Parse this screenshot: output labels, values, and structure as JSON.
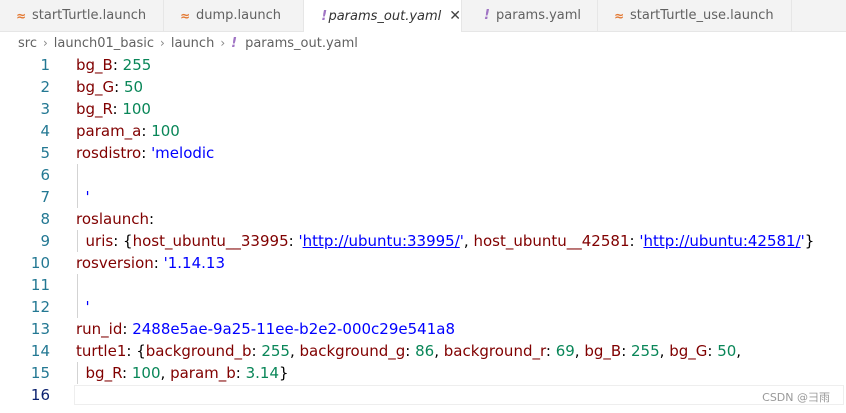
{
  "tabs": [
    {
      "label": "startTurtle.launch",
      "icon": "xml-icon",
      "italic": false,
      "active": false,
      "width": 164
    },
    {
      "label": "dump.launch",
      "icon": "xml-icon",
      "italic": false,
      "active": false,
      "width": 140
    },
    {
      "label": "params_out.yaml",
      "icon": "yaml-icon",
      "italic": true,
      "active": true,
      "width": 158
    },
    {
      "label": "params.yaml",
      "icon": "yaml-icon",
      "italic": false,
      "active": false,
      "width": 136
    },
    {
      "label": "startTurtle_use.launch",
      "icon": "xml-icon",
      "italic": false,
      "active": false,
      "width": 194
    }
  ],
  "breadcrumb": [
    "src",
    "launch01_basic",
    "launch",
    "params_out.yaml"
  ],
  "lines": [
    [
      {
        "t": "bg_B",
        "c": "key"
      },
      {
        "t": ": ",
        "c": "plain"
      },
      {
        "t": "255",
        "c": "num"
      }
    ],
    [
      {
        "t": "bg_G",
        "c": "key"
      },
      {
        "t": ": ",
        "c": "plain"
      },
      {
        "t": "50",
        "c": "num"
      }
    ],
    [
      {
        "t": "bg_R",
        "c": "key"
      },
      {
        "t": ": ",
        "c": "plain"
      },
      {
        "t": "100",
        "c": "num"
      }
    ],
    [
      {
        "t": "param_a",
        "c": "key"
      },
      {
        "t": ": ",
        "c": "plain"
      },
      {
        "t": "100",
        "c": "num"
      }
    ],
    [
      {
        "t": "rosdistro",
        "c": "key"
      },
      {
        "t": ": ",
        "c": "plain"
      },
      {
        "t": "'melodic",
        "c": "str"
      }
    ],
    [],
    [
      {
        "t": "  '",
        "c": "str"
      }
    ],
    [
      {
        "t": "roslaunch",
        "c": "key"
      },
      {
        "t": ":",
        "c": "plain"
      }
    ],
    [
      {
        "t": "  uris",
        "c": "key"
      },
      {
        "t": ": {",
        "c": "plain"
      },
      {
        "t": "host_ubuntu__33995",
        "c": "key"
      },
      {
        "t": ": ",
        "c": "plain"
      },
      {
        "t": "'",
        "c": "str"
      },
      {
        "t": "http://ubuntu:33995/",
        "c": "link"
      },
      {
        "t": "'",
        "c": "str"
      },
      {
        "t": ", ",
        "c": "plain"
      },
      {
        "t": "host_ubuntu__42581",
        "c": "key"
      },
      {
        "t": ": ",
        "c": "plain"
      },
      {
        "t": "'",
        "c": "str"
      },
      {
        "t": "http://ubuntu:42581/",
        "c": "link"
      },
      {
        "t": "'",
        "c": "str"
      },
      {
        "t": "}",
        "c": "plain"
      }
    ],
    [
      {
        "t": "rosversion",
        "c": "key"
      },
      {
        "t": ": ",
        "c": "plain"
      },
      {
        "t": "'1.14.13",
        "c": "str"
      }
    ],
    [],
    [
      {
        "t": "  '",
        "c": "str"
      }
    ],
    [
      {
        "t": "run_id",
        "c": "key"
      },
      {
        "t": ": ",
        "c": "plain"
      },
      {
        "t": "2488e5ae-9a25-11ee-b2e2-000c29e541a8",
        "c": "str"
      }
    ],
    [
      {
        "t": "turtle1",
        "c": "key"
      },
      {
        "t": ": {",
        "c": "plain"
      },
      {
        "t": "background_b",
        "c": "key"
      },
      {
        "t": ": ",
        "c": "plain"
      },
      {
        "t": "255",
        "c": "num"
      },
      {
        "t": ", ",
        "c": "plain"
      },
      {
        "t": "background_g",
        "c": "key"
      },
      {
        "t": ": ",
        "c": "plain"
      },
      {
        "t": "86",
        "c": "num"
      },
      {
        "t": ", ",
        "c": "plain"
      },
      {
        "t": "background_r",
        "c": "key"
      },
      {
        "t": ": ",
        "c": "plain"
      },
      {
        "t": "69",
        "c": "num"
      },
      {
        "t": ", ",
        "c": "plain"
      },
      {
        "t": "bg_B",
        "c": "key"
      },
      {
        "t": ": ",
        "c": "plain"
      },
      {
        "t": "255",
        "c": "num"
      },
      {
        "t": ", ",
        "c": "plain"
      },
      {
        "t": "bg_G",
        "c": "key"
      },
      {
        "t": ": ",
        "c": "plain"
      },
      {
        "t": "50",
        "c": "num"
      },
      {
        "t": ",",
        "c": "plain"
      }
    ],
    [
      {
        "t": "  bg_R",
        "c": "key"
      },
      {
        "t": ": ",
        "c": "plain"
      },
      {
        "t": "100",
        "c": "num"
      },
      {
        "t": ", ",
        "c": "plain"
      },
      {
        "t": "param_b",
        "c": "key"
      },
      {
        "t": ": ",
        "c": "plain"
      },
      {
        "t": "3.14",
        "c": "num"
      },
      {
        "t": "}",
        "c": "plain"
      }
    ],
    []
  ],
  "current_line": 16,
  "watermark": "CSDN @彐雨",
  "colors": {
    "key": "#800000",
    "number": "#098658",
    "string": "#0000ff",
    "line_number": "#237893"
  }
}
